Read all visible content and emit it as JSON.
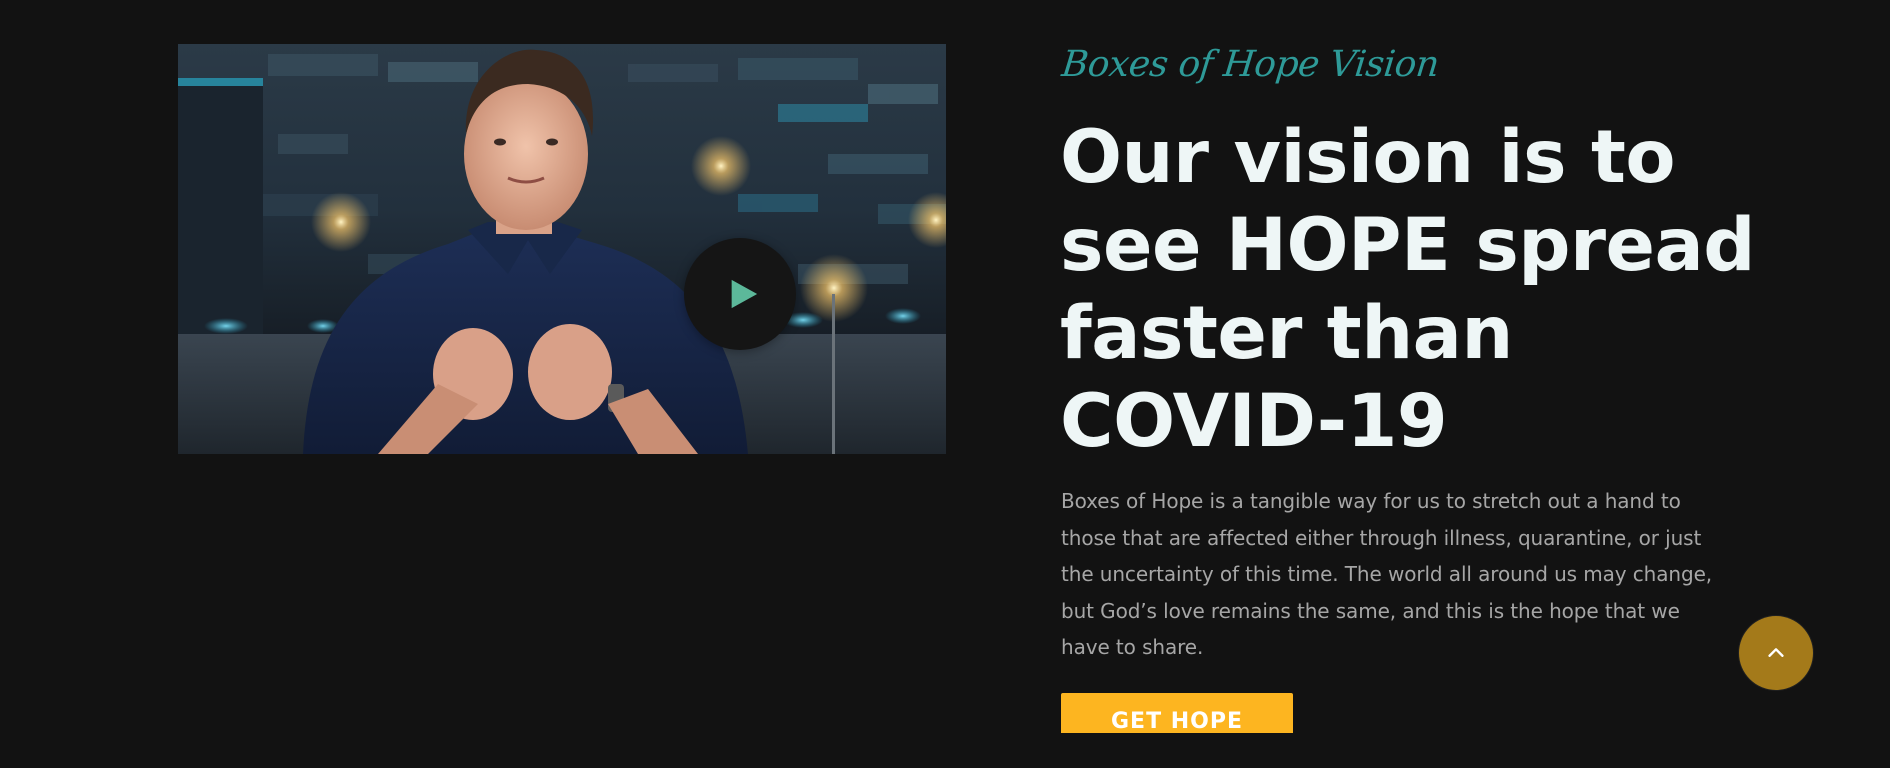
{
  "video": {
    "thumbnail_subject": "man speaking in front of a lit brick wall",
    "play_icon": "play-icon",
    "play_color": "#5cb89a"
  },
  "section": {
    "eyebrow": "Boxes of Hope Vision",
    "heading": "Our vision is to see HOPE spread faster than COVID-19",
    "body": "Boxes of Hope is a tangible way for us to stretch out a hand to those that are affected either through illness, quarantine, or just the uncertainty of this time. The world all around us may change, but God’s love remains the same, and this is the hope that we have to share.",
    "cta_label": "GET HOPE"
  },
  "scroll_top": {
    "icon": "chevron-up-icon"
  },
  "colors": {
    "background": "#121212",
    "accent_teal": "#2e9a98",
    "heading": "#eef6f6",
    "body_text": "#a6a6a6",
    "cta": "#fdb520",
    "scroll_top": "#a47a1a"
  }
}
